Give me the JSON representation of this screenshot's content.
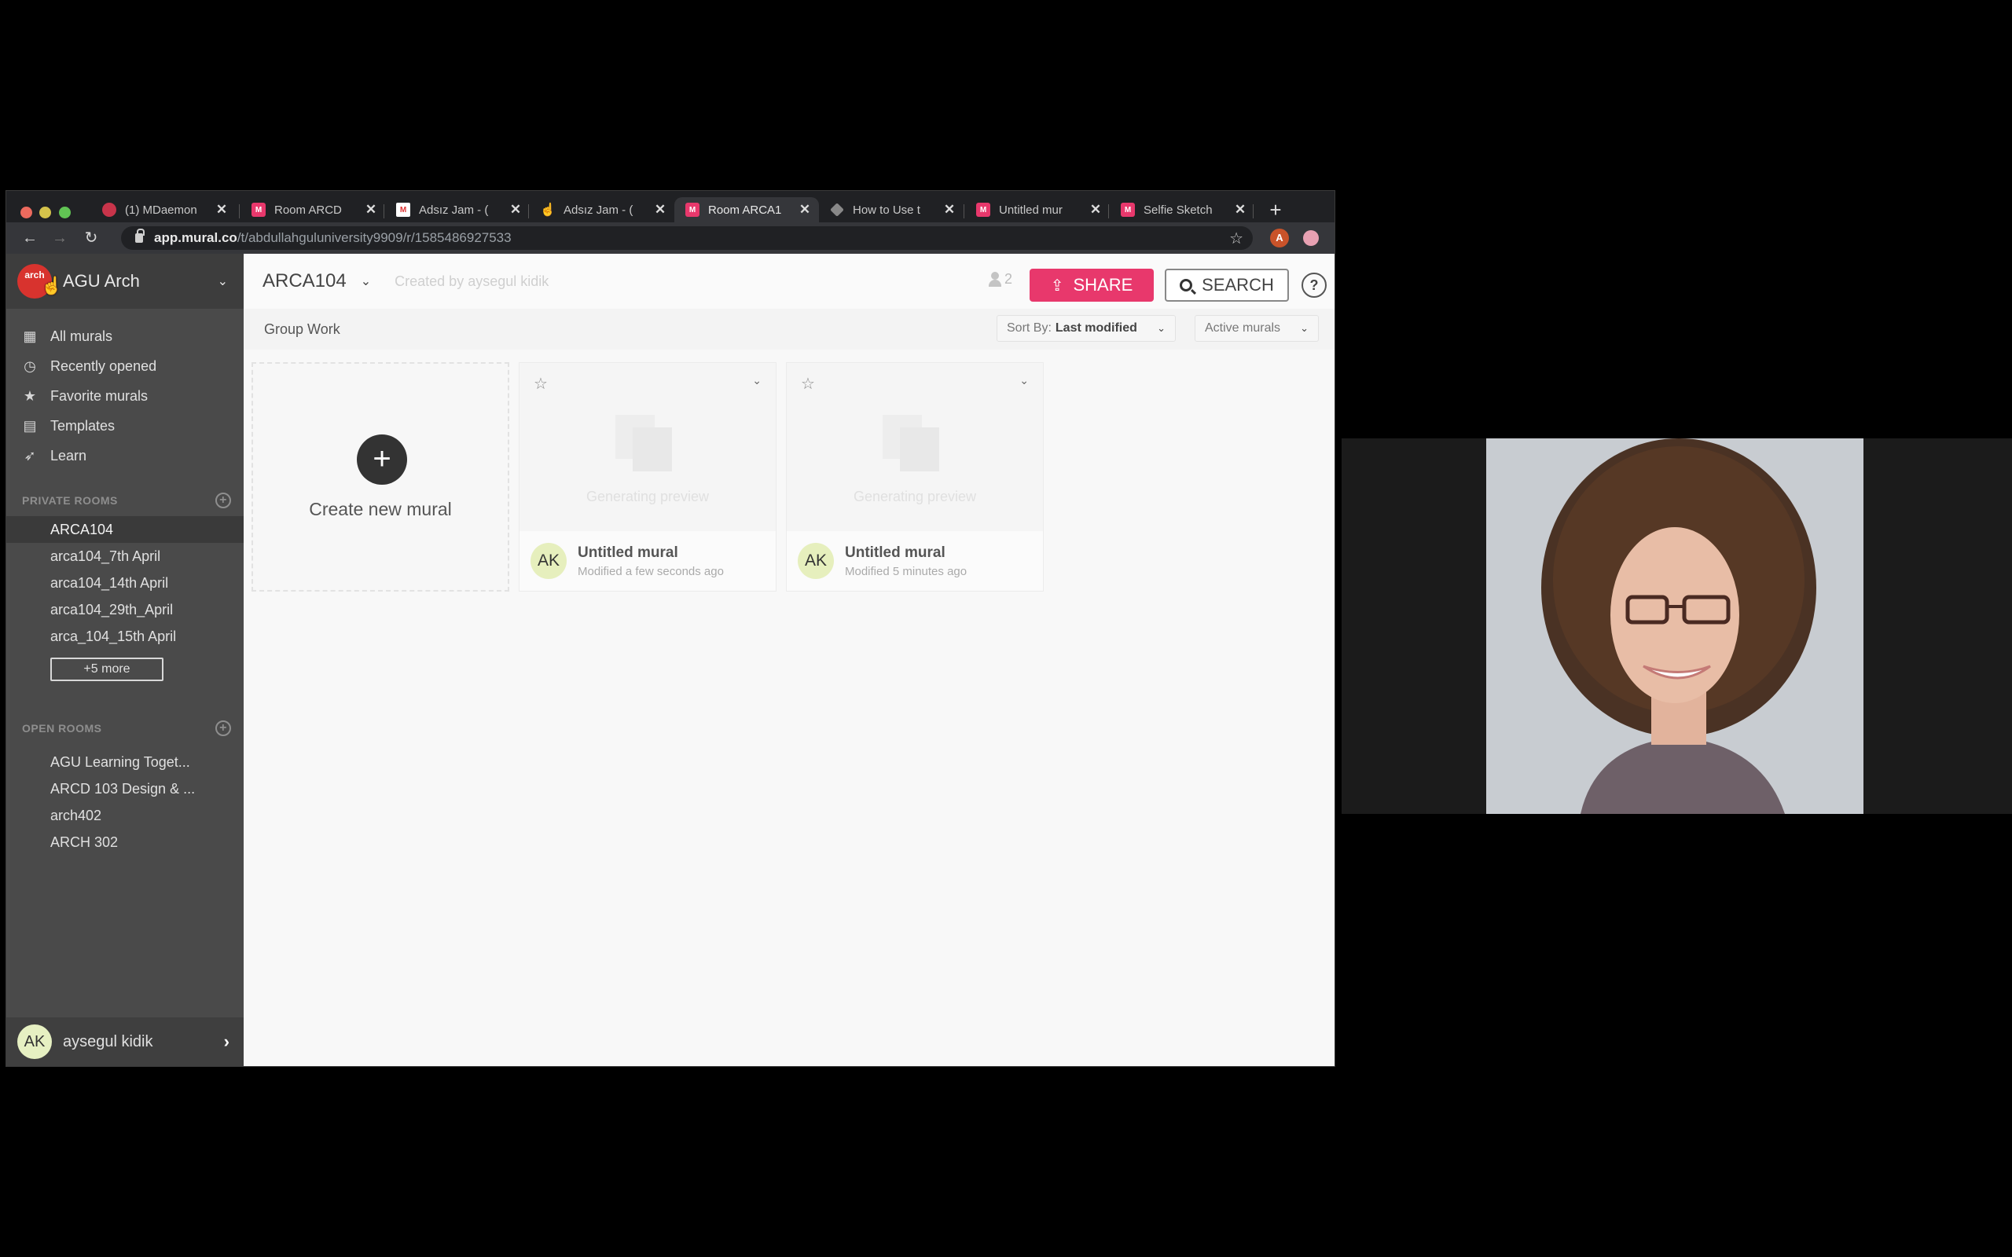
{
  "browser": {
    "tabs": [
      {
        "label": "(1) MDaemon",
        "favicon": "mdaemon-icon",
        "active": false
      },
      {
        "label": "Room ARCD",
        "favicon": "mural-icon",
        "active": false
      },
      {
        "label": "Adsız Jam - (",
        "favicon": "gmail-icon",
        "active": false
      },
      {
        "label": "Adsız Jam - (",
        "favicon": "hand-icon",
        "active": false
      },
      {
        "label": "Room ARCA1",
        "favicon": "mural-icon",
        "active": true
      },
      {
        "label": "How to Use t",
        "favicon": "diamond-icon",
        "active": false
      },
      {
        "label": "Untitled mur",
        "favicon": "mural-icon",
        "active": false
      },
      {
        "label": "Selfie Sketch",
        "favicon": "mural-icon",
        "active": false
      }
    ],
    "close_glyph": "✕",
    "new_tab_glyph": "+",
    "url_host": "app.mural.co",
    "url_path": "/t/abdullahguluniversity9909/r/1585486927533",
    "profile_initial": "A"
  },
  "sidebar": {
    "workspace_logo": "arch",
    "workspace_name": "AGU Arch",
    "nav": [
      {
        "label": "All murals",
        "icon": "grid-icon"
      },
      {
        "label": "Recently opened",
        "icon": "clock-icon"
      },
      {
        "label": "Favorite murals",
        "icon": "star-icon"
      },
      {
        "label": "Templates",
        "icon": "template-icon"
      },
      {
        "label": "Learn",
        "icon": "rocket-icon"
      }
    ],
    "private_rooms": {
      "title": "PRIVATE ROOMS",
      "items": [
        "ARCA104",
        "arca104_7th April",
        "arca104_14th April",
        "arca104_29th_April",
        "arca_104_15th April"
      ],
      "active_index": 0,
      "more_label": "+5 more"
    },
    "open_rooms": {
      "title": "OPEN ROOMS",
      "items": [
        "AGU Learning Toget...",
        "ARCD 103 Design & ...",
        "arch402",
        "ARCH 302"
      ]
    },
    "user": {
      "initials": "AK",
      "name": "aysegul kidik"
    }
  },
  "main": {
    "room_title": "ARCA104",
    "created_by": "Created by aysegul kidik",
    "member_count": "2",
    "share_label": "SHARE",
    "search_label": "SEARCH",
    "help_label": "?",
    "group_label": "Group Work",
    "sort_prefix": "Sort By:",
    "sort_value": "Last modified",
    "filter_value": "Active murals",
    "create_label": "Create new mural",
    "murals": [
      {
        "title": "Untitled mural",
        "modified": "Modified a few seconds ago",
        "owner_initials": "AK",
        "preview_status": "Generating preview"
      },
      {
        "title": "Untitled mural",
        "modified": "Modified 5 minutes ago",
        "owner_initials": "AK",
        "preview_status": "Generating preview"
      }
    ]
  },
  "colors": {
    "accent": "#e8386c",
    "sidebar_bg": "#4a4a4a",
    "avatar_bg": "#e6efbd"
  }
}
